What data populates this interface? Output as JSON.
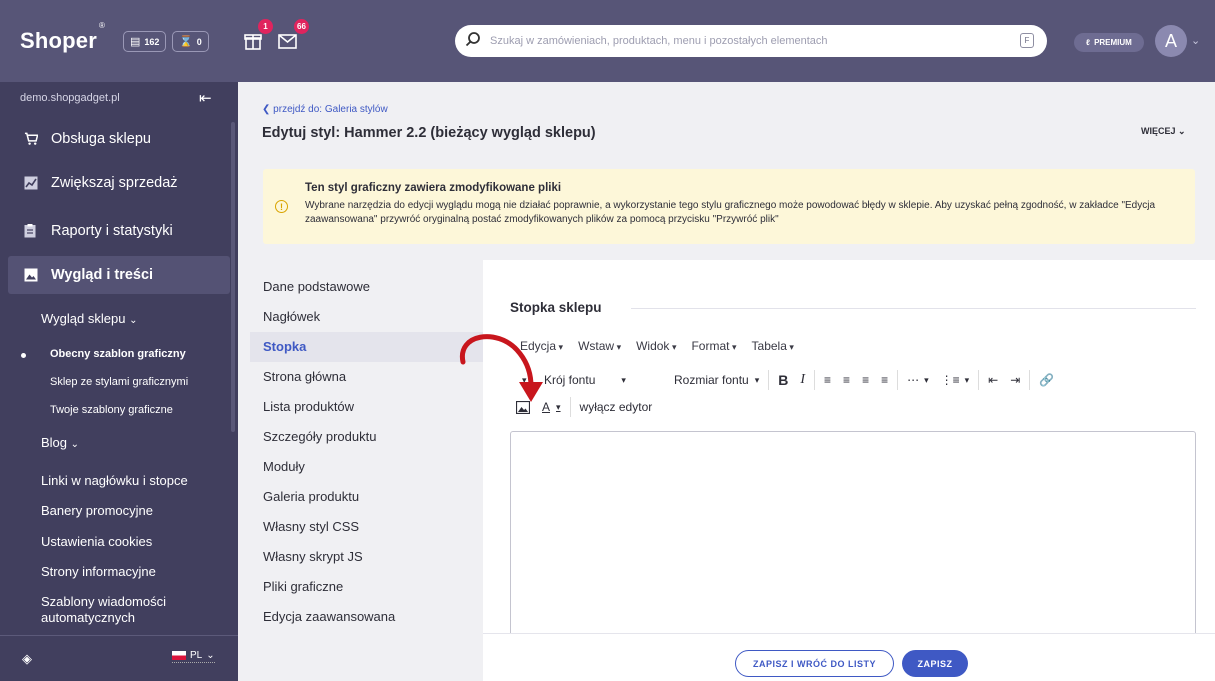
{
  "topbar": {
    "logo": "Shoper",
    "logo_mark": "®",
    "orders_count": "162",
    "pending_count": "0",
    "gift_badge": "1",
    "mail_badge": "66",
    "search_placeholder": "Szukaj w zamówieniach, produktach, menu i pozostałych elementach",
    "search_shortcut": "F",
    "premium_label": "PREMIUM",
    "avatar_initial": "A"
  },
  "sidebar": {
    "domain": "demo.shopgadget.pl",
    "items": [
      {
        "label": "Obsługa sklepu",
        "icon": "cart-icon"
      },
      {
        "label": "Zwiększaj sprzedaż",
        "icon": "chart-icon"
      },
      {
        "label": "Raporty i statystyki",
        "icon": "report-icon"
      },
      {
        "label": "Wygląd i treści",
        "icon": "image-icon"
      }
    ],
    "sub_items": {
      "wyglad_sklepu": "Wygląd sklepu",
      "obecny": "Obecny szablon graficzny",
      "sklep_ze_stylami": "Sklep ze stylami graficznymi",
      "twoje": "Twoje szablony graficzne",
      "blog": "Blog",
      "linki": "Linki w nagłówku i stopce",
      "banery": "Banery promocyjne",
      "cookies": "Ustawienia cookies",
      "strony": "Strony informacyjne",
      "szablony_1": "Szablony wiadomości",
      "szablony_2": "automatycznych"
    },
    "language": "PL"
  },
  "content": {
    "back_link": "przejdź do: Galeria stylów",
    "title": "Edytuj styl: Hammer 2.2 (bieżący wygląd sklepu)",
    "more": "WIĘCEJ",
    "warning": {
      "title": "Ten styl graficzny zawiera zmodyfikowane pliki",
      "text": "Wybrane narzędzia do edycji wyglądu mogą nie działać poprawnie, a wykorzystanie tego stylu graficznego może powodować błędy w sklepie. Aby uzyskać pełną zgodność, w zakładce \"Edycja zaawansowana\" przywróć oryginalną postać zmodyfikowanych plików za pomocą przycisku \"Przywróć plik\""
    },
    "style_nav": [
      "Dane podstawowe",
      "Nagłówek",
      "Stopka",
      "Strona główna",
      "Lista produktów",
      "Szczegóły produktu",
      "Moduły",
      "Galeria produktu",
      "Własny styl CSS",
      "Własny skrypt JS",
      "Pliki graficzne",
      "Edycja zaawansowana"
    ],
    "panel": {
      "title": "Stopka sklepu",
      "menus": [
        "Edycja",
        "Wstaw",
        "Widok",
        "Format",
        "Tabela"
      ],
      "font_family": "Krój fontu",
      "font_size": "Rozmiar fontu",
      "bold": "B",
      "italic": "I",
      "text_color_glyph": "A",
      "disable_editor": "wyłącz edytor"
    },
    "buttons": {
      "save_and_back": "ZAPISZ I WRÓĆ DO LISTY",
      "save": "ZAPISZ"
    }
  },
  "colors": {
    "topbar": "#575577",
    "sidebar": "#413f5e",
    "accent": "#3f59c4",
    "badge": "#e0245e",
    "warning_bg": "#fdf7d9",
    "annotation_arrow": "#c8161d"
  }
}
